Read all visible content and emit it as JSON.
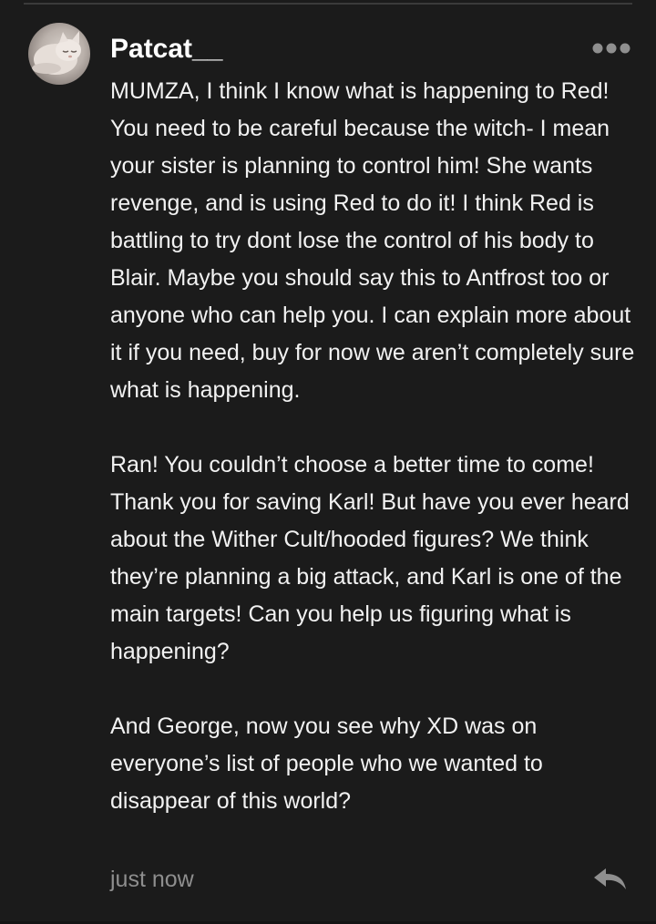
{
  "comment": {
    "author": "Patcat__",
    "paragraphs": [
      "MUMZA, I think I know what is happening to Red! You need to be careful because the witch- I mean your sister is planning to control him! She wants revenge, and is using Red to do it! I think Red is battling to try dont lose the control of his body to Blair. Maybe you should say this to Antfrost too or anyone who can help you. I can explain more about it if you need, buy for now we aren’t completely sure what is happening.",
      "Ran! You couldn’t choose a better time to come! Thank you for saving Karl! But have you ever heard about the Wither Cult/hooded figures? We think they’re planning a big attack, and Karl is one of the main targets! Can you help us figuring what is happening?",
      "And George, now you see why XD was on everyone’s list of people who we wanted to disappear of this world?"
    ],
    "timestamp": "just now"
  },
  "icons": {
    "more": "more-options-icon",
    "reply": "reply-icon",
    "avatar": "cat-avatar"
  },
  "colors": {
    "background": "#1b1b1b",
    "text": "#f2f2f2",
    "muted": "#8e8e8e"
  }
}
